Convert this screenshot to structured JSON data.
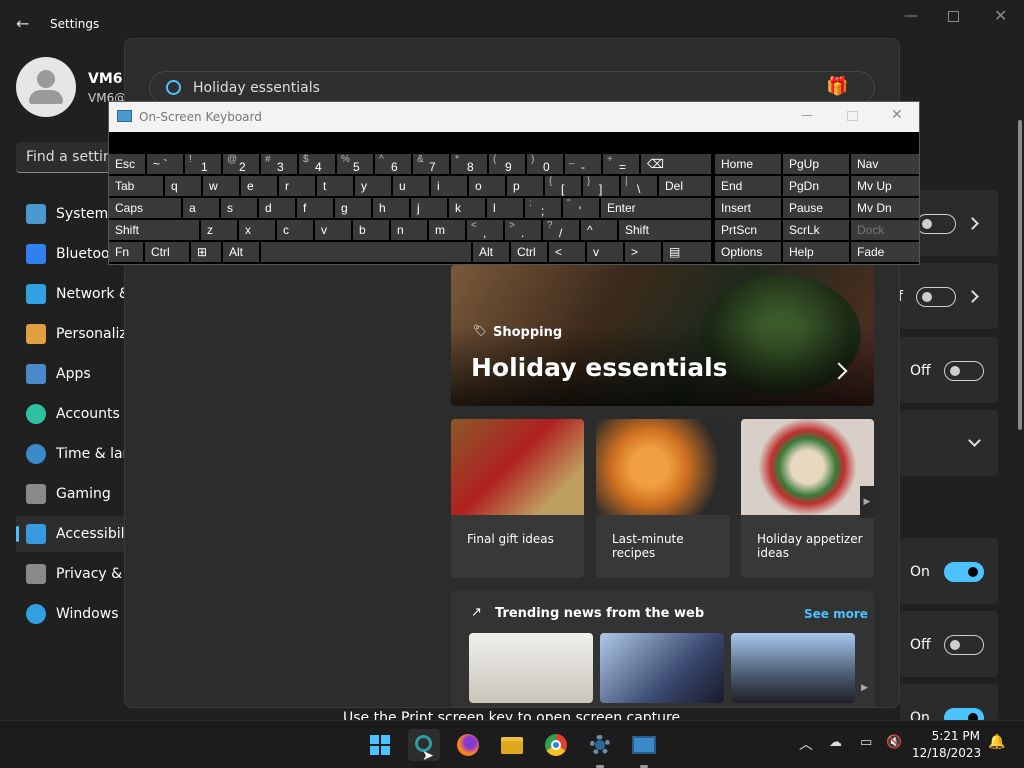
{
  "settings": {
    "title": "Settings",
    "user": {
      "name": "VM6",
      "email": "VM6@"
    },
    "find_placeholder": "Find a setting",
    "nav": [
      {
        "label": "System",
        "icon": "monitor-icon"
      },
      {
        "label": "Bluetooth & devices",
        "icon": "bluetooth-icon"
      },
      {
        "label": "Network & internet",
        "icon": "wifi-icon"
      },
      {
        "label": "Personalization",
        "icon": "brush-icon"
      },
      {
        "label": "Apps",
        "icon": "apps-icon"
      },
      {
        "label": "Accounts",
        "icon": "person-icon"
      },
      {
        "label": "Time & language",
        "icon": "clock-icon"
      },
      {
        "label": "Gaming",
        "icon": "gamepad-icon"
      },
      {
        "label": "Accessibility",
        "icon": "accessibility-icon"
      },
      {
        "label": "Privacy & security",
        "icon": "shield-icon"
      },
      {
        "label": "Windows Update",
        "icon": "update-icon"
      }
    ],
    "rows": [
      {
        "state": "",
        "toggle": false
      },
      {
        "state": "f",
        "toggle": false
      },
      {
        "state": "Off",
        "toggle": false
      },
      {
        "state": "On",
        "toggle": true
      },
      {
        "state": "Off",
        "toggle": false
      },
      {
        "state": "On",
        "toggle": true
      }
    ],
    "bottom_text": "Use the Print screen key to open screen capture"
  },
  "search": {
    "query": "Holiday essentials",
    "hero": {
      "tag": "Shopping",
      "title": "Holiday essentials"
    },
    "cards": [
      {
        "label": "Final gift ideas"
      },
      {
        "label": "Last-minute recipes"
      },
      {
        "label": "Holiday appetizer ideas"
      }
    ],
    "trending": {
      "title": "Trending news from the web",
      "see_more": "See more"
    }
  },
  "osk": {
    "title": "On-Screen Keyboard",
    "rows": [
      [
        [
          "Esc",
          ""
        ],
        [
          "~ `",
          ""
        ],
        [
          "1",
          "!"
        ],
        [
          "2",
          "@"
        ],
        [
          "3",
          "#"
        ],
        [
          "4",
          "$"
        ],
        [
          "5",
          "%"
        ],
        [
          "6",
          "^"
        ],
        [
          "7",
          "&"
        ],
        [
          "8",
          "*"
        ],
        [
          "9",
          "("
        ],
        [
          "0",
          ")"
        ],
        [
          "-",
          "_"
        ],
        [
          "=",
          "+"
        ],
        [
          "⌫",
          ""
        ]
      ],
      [
        [
          "Tab",
          ""
        ],
        [
          "q",
          ""
        ],
        [
          "w",
          ""
        ],
        [
          "e",
          ""
        ],
        [
          "r",
          ""
        ],
        [
          "t",
          ""
        ],
        [
          "y",
          ""
        ],
        [
          "u",
          ""
        ],
        [
          "i",
          ""
        ],
        [
          "o",
          ""
        ],
        [
          "p",
          ""
        ],
        [
          "[",
          "{"
        ],
        [
          "]",
          "}"
        ],
        [
          "\\",
          "|"
        ],
        [
          "Del",
          ""
        ]
      ],
      [
        [
          "Caps",
          ""
        ],
        [
          "a",
          ""
        ],
        [
          "s",
          ""
        ],
        [
          "d",
          ""
        ],
        [
          "f",
          ""
        ],
        [
          "g",
          ""
        ],
        [
          "h",
          ""
        ],
        [
          "j",
          ""
        ],
        [
          "k",
          ""
        ],
        [
          "l",
          ""
        ],
        [
          ";",
          ":"
        ],
        [
          "'",
          "\""
        ],
        [
          "Enter",
          ""
        ]
      ],
      [
        [
          "Shift",
          ""
        ],
        [
          "z",
          ""
        ],
        [
          "x",
          ""
        ],
        [
          "c",
          ""
        ],
        [
          "v",
          ""
        ],
        [
          "b",
          ""
        ],
        [
          "n",
          ""
        ],
        [
          "m",
          ""
        ],
        [
          ",",
          "<"
        ],
        [
          ".",
          ">"
        ],
        [
          "/",
          "?"
        ],
        [
          "^",
          ""
        ],
        [
          "Shift",
          ""
        ]
      ],
      [
        [
          "Fn",
          ""
        ],
        [
          "Ctrl",
          ""
        ],
        [
          "⊞",
          ""
        ],
        [
          "Alt",
          ""
        ],
        [
          "",
          ""
        ],
        [
          "Alt",
          ""
        ],
        [
          "Ctrl",
          ""
        ],
        [
          "<",
          ""
        ],
        [
          "v",
          ""
        ],
        [
          ">",
          ""
        ],
        [
          "▤",
          ""
        ]
      ]
    ],
    "nav_keys": [
      [
        "Home",
        "PgUp",
        "Nav"
      ],
      [
        "End",
        "PgDn",
        "Mv Up"
      ],
      [
        "Insert",
        "Pause",
        "Mv Dn"
      ],
      [
        "PrtScn",
        "ScrLk",
        "Dock"
      ],
      [
        "Options",
        "Help",
        "Fade"
      ]
    ]
  },
  "taskbar": {
    "apps": [
      "windows-start-icon",
      "search-icon",
      "firefox-icon",
      "file-explorer-icon",
      "chrome-icon",
      "settings-gear-icon",
      "remote-desktop-icon"
    ],
    "time": "5:21 PM",
    "date": "12/18/2023"
  },
  "colors": {
    "accent": "#4cc2ff",
    "background": "#202020"
  }
}
